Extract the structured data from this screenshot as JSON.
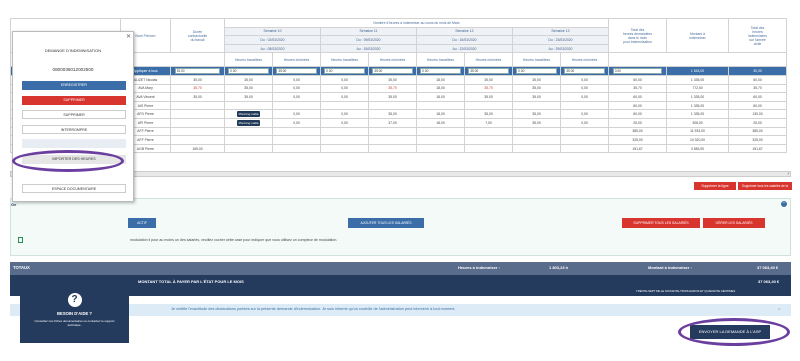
{
  "header": {
    "main": "Nombre d'heures à indemniser au cours du mois de Mars",
    "salarie_prenom": "Nom Prénom",
    "duree": [
      "Durée",
      "contractuelle",
      "du travail"
    ],
    "weeks": [
      {
        "label": "Semaine 10",
        "du": "Du : 02/03/2020",
        "au": "Au : 08/03/2020"
      },
      {
        "label": "Semaine 11",
        "du": "Du : 09/03/2020",
        "au": "Au : 15/03/2020"
      },
      {
        "label": "Semaine 12",
        "du": "Du : 16/03/2020",
        "au": "Au : 22/03/2020"
      },
      {
        "label": "Semaine 13",
        "du": "Du : 23/03/2020",
        "au": "Au : 29/03/2020"
      }
    ],
    "sub_a": "Heures travaillées",
    "sub_b": "Heures chômées",
    "total_heures": [
      "Total des",
      "heures demandées",
      "dans le mois",
      "pour indemnisation"
    ],
    "montant": [
      "Montant à",
      "indemniser"
    ],
    "total_indemn": [
      "Total des",
      "heures",
      "indemnisées",
      "sur l'année",
      "civile"
    ]
  },
  "rows": [
    {
      "name": "Appliquer à tous",
      "duree": "35.00",
      "cells": [
        "0.00",
        "35.00",
        "0.00",
        "35.00",
        "0.00",
        "35.00",
        "0.00",
        "35.00"
      ],
      "total": "0.00",
      "montant": "1 543,00",
      "ann": "30,00"
    },
    {
      "name": "ALIZET Nicolas",
      "duree": "35,00",
      "cells": [
        "35,00",
        "0,00",
        "0,00",
        "35,00",
        "18,00",
        "35,00",
        "35,00",
        "0,00"
      ],
      "total": "60,00",
      "montant": "1 335,00",
      "ann": "60,00"
    },
    {
      "name": "AVA Mary",
      "duree": "35,70",
      "cells": [
        "35,00",
        "0,00",
        "0,00",
        "35,70",
        "18,00",
        "35,70",
        "35,00",
        "0,00"
      ],
      "total": "35,70",
      "montant": "772,00",
      "ann": "35,70"
    },
    {
      "name": "AVA Vincent",
      "duree": "35,00",
      "cells": [
        "35,00",
        "0,00",
        "0,00",
        "35,00",
        "18,00",
        "35,00",
        "35,00",
        "0,00"
      ],
      "total": "60,00",
      "montant": "1 335,00",
      "ann": "60,00"
    },
    {
      "name": "AIS Pierre",
      "duree": "",
      "cells": [
        "",
        "",
        "",
        "",
        "",
        "",
        "",
        ""
      ],
      "total": "60,00",
      "montant": "1 335,00",
      "ann": "60,00"
    },
    {
      "name": "AFD Pierre",
      "duree": "",
      "cells": [
        "35,00",
        "0,00",
        "0,00",
        "35,00",
        "18,00",
        "35,00",
        "35,00",
        "0,00"
      ],
      "total": "60,00",
      "montant": "1 335,00",
      "ann": "130,00",
      "btn": "Planning mafia"
    },
    {
      "name": "API Pierre",
      "duree": "",
      "cells": [
        "35,00",
        "0,00",
        "0,00",
        "37,00",
        "18,00",
        "7,00",
        "35,00",
        "0,00"
      ],
      "total": "25,00",
      "montant": "308,00",
      "ann": "25,00",
      "btn": "Planning mafia"
    },
    {
      "name": "AFF Pierre",
      "duree": "",
      "cells": [
        "",
        "",
        "",
        "",
        "",
        "",
        "",
        ""
      ],
      "total": "385,00",
      "montant": "11 933,00",
      "ann": "385,00"
    },
    {
      "name": "AFF Pierre",
      "duree": "",
      "cells": [
        "",
        "",
        "",
        "",
        "",
        "",
        "",
        ""
      ],
      "total": "325,00",
      "montant": "10 320,00",
      "ann": "325,00"
    },
    {
      "name": "AGB Pierre",
      "duree": "169,00",
      "cells": [
        "",
        "",
        "",
        "",
        "",
        "",
        "",
        ""
      ],
      "total": "151,67",
      "montant": "3 583,90",
      "ann": "151,67"
    }
  ],
  "menu": {
    "title": "DEMANDE D'INDEMNISATION",
    "number": "0800036012002500",
    "btn1": "ENREGISTRER",
    "btn2": "SUPPRIMER",
    "btn3": "SUPPRIMER",
    "btn4": "INTERROMPRE",
    "btn5": "",
    "btn6": "IMPORTER DES HEURES",
    "btn7": "ESPACE DOCUMENTAIRE"
  },
  "buttons": {
    "suppr_ligne": "Supprimer la ligne",
    "suppr_tous": "Supprimer tous les salariés de la page",
    "actif": "ACTIF",
    "ajouter": "AJOUTER TOUS LES SALARIÉS",
    "suppr_all": "SUPPRIMER TOUS LES SALARIÉS",
    "gerer": "GÉRER LES SALARIÉS",
    "envoyer": "ENVOYER LA DEMANDE À L'ASP"
  },
  "help": {
    "title": "BESOIN D'AIDE ?",
    "text": "Consultez nos fiches documentaires ou contactez le support technique.",
    "icon": "question-icon"
  },
  "notice": "modulation il pour au moins un des salariés, veuillez cocher cette case pour indiquer que vous utilisez un compteur de modulation.",
  "totals": {
    "label": "TOTAUX",
    "heures_label": "Heures à indemniser :",
    "heures_value": "1 803,23 h",
    "montant_label": "Montant à indemniser :",
    "montant_value": "37 063,40 €",
    "payer_label": "MONTANT TOTAL À PAYER PAR L'ÉTAT POUR LE MOIS",
    "payer_value": "37 063,40 €",
    "payer_words": "TRENTE-SEPT MILLE SOIXANTE-TROIS EUROS ET QUARANTE CENTIMES"
  },
  "certify": "Je certifie l'exactitude des déclarations portées sur la présente demande d'indemnisation. Je suis informé qu'un contrôle de l'administration peut intervenir à tout moment.",
  "colors": {
    "navy": "#243b5e",
    "blue": "#3b6ea8",
    "red": "#d8352f",
    "purple": "#6b3fa0"
  }
}
